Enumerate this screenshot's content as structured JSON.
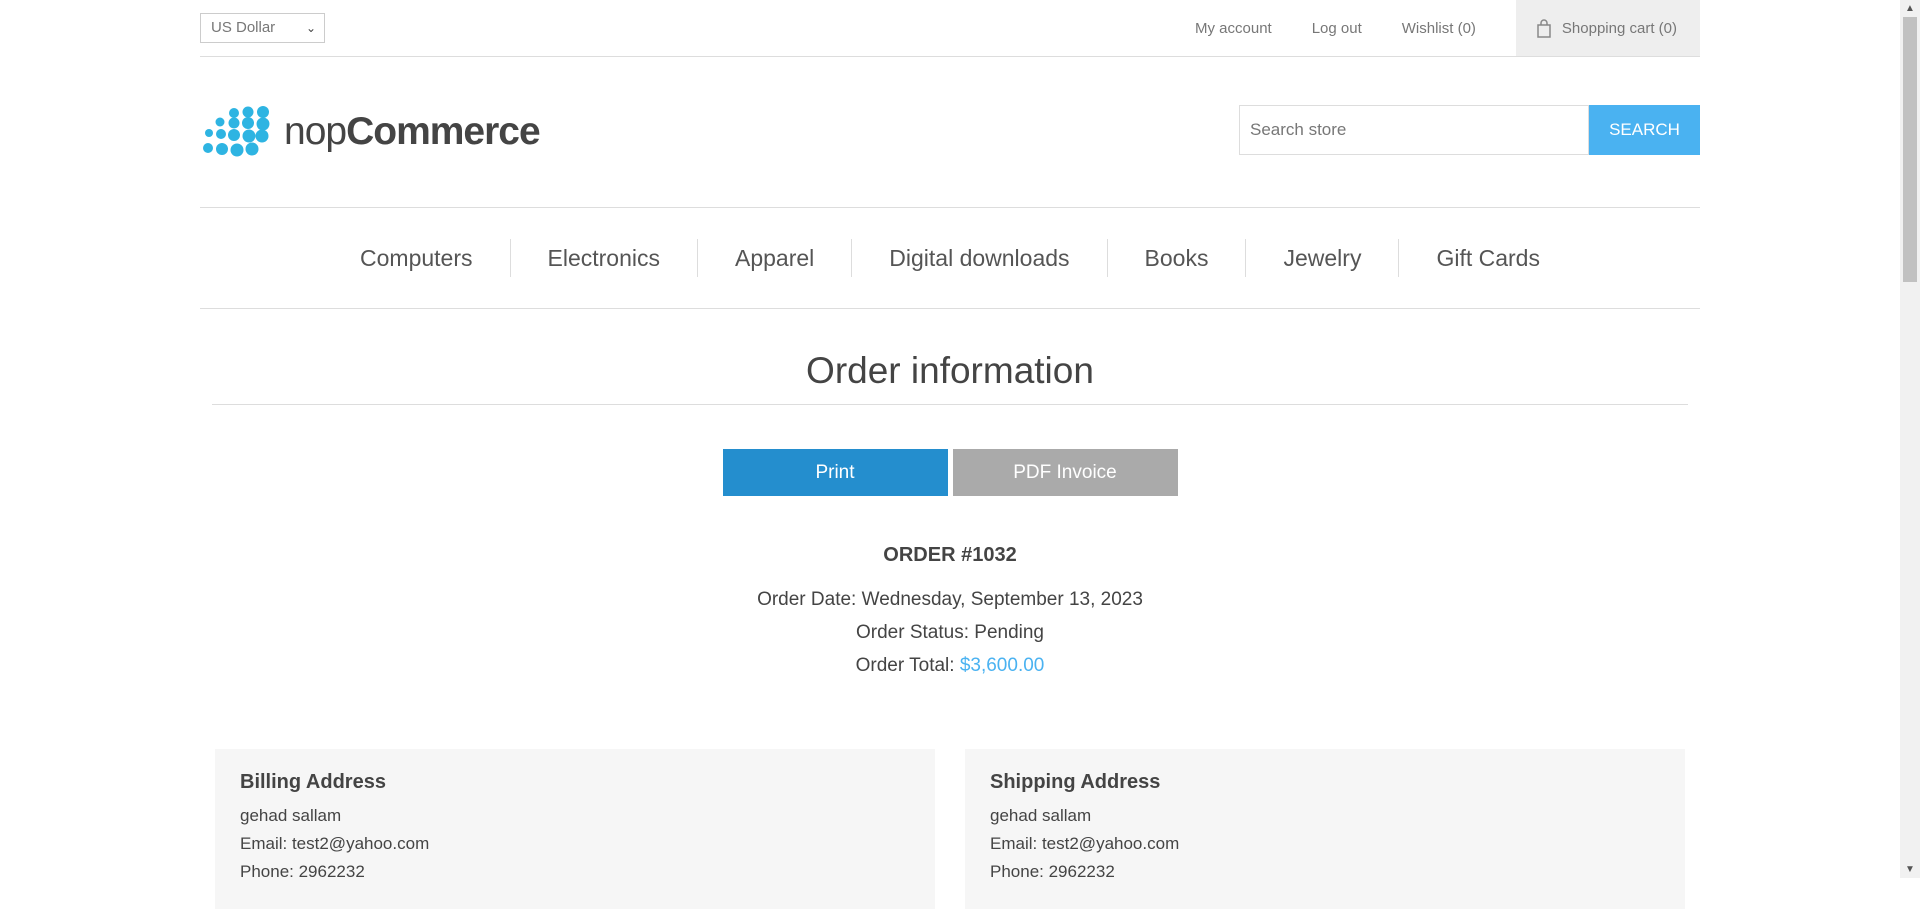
{
  "header": {
    "currency": "US Dollar",
    "links": {
      "my_account": "My account",
      "logout": "Log out",
      "wishlist": "Wishlist (0)",
      "cart": "Shopping cart (0)"
    },
    "logo": {
      "light": "nop",
      "bold": "Commerce"
    },
    "search": {
      "placeholder": "Search store",
      "button": "SEARCH"
    }
  },
  "nav": [
    "Computers",
    "Electronics",
    "Apparel",
    "Digital downloads",
    "Books",
    "Jewelry",
    "Gift Cards"
  ],
  "page": {
    "title": "Order information",
    "print_label": "Print",
    "pdf_label": "PDF Invoice",
    "order_number": "ORDER #1032",
    "order_date": "Order Date: Wednesday, September 13, 2023",
    "order_status": "Order Status: Pending",
    "order_total_label": "Order Total: ",
    "order_total_value": "$3,600.00"
  },
  "billing": {
    "title": "Billing Address",
    "name": "gehad sallam",
    "email": "Email: test2@yahoo.com",
    "phone": "Phone: 2962232"
  },
  "shipping": {
    "title": "Shipping Address",
    "name": "gehad sallam",
    "email": "Email: test2@yahoo.com",
    "phone": "Phone: 2962232"
  },
  "colors": {
    "accent": "#4ab2f1",
    "print": "#248ece",
    "pdf": "#aaaaaa"
  }
}
